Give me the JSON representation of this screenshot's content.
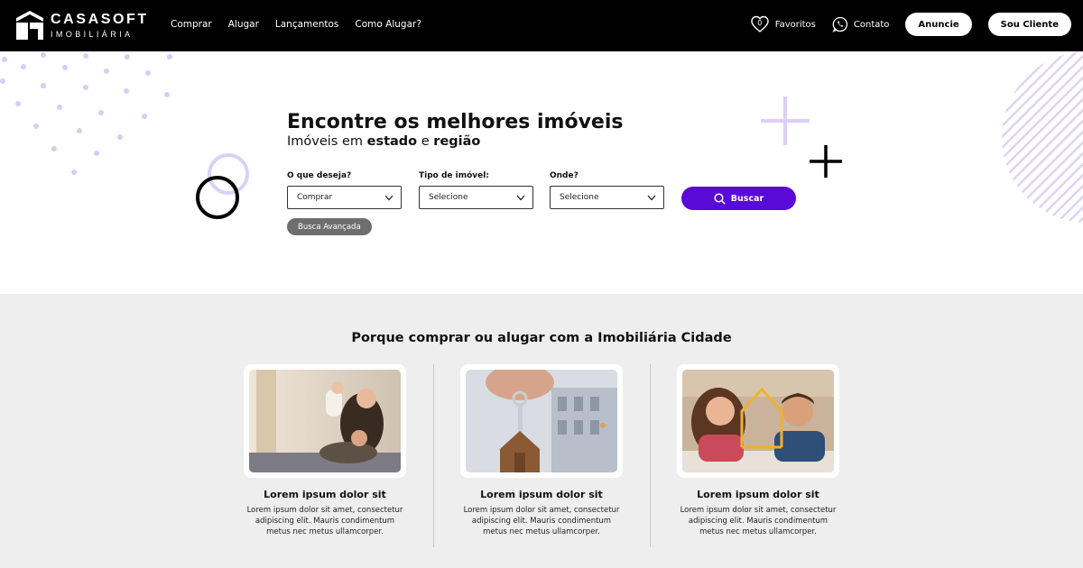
{
  "brand": {
    "name": "CASASOFT",
    "tagline": "IMOBILIÁRIA"
  },
  "nav": {
    "items": [
      "Comprar",
      "Alugar",
      "Lançamentos",
      "Como Alugar?"
    ]
  },
  "header_right": {
    "favorites_count": "0",
    "favorites_label": "Favoritos",
    "contact_label": "Contato",
    "announce_button": "Anuncie",
    "client_button": "Sou Cliente"
  },
  "hero": {
    "title": "Encontre os melhores imóveis",
    "subtitle_prefix": "Imóveis em ",
    "subtitle_state": "estado",
    "subtitle_mid": " e ",
    "subtitle_region": "região",
    "fields": [
      {
        "label": "O que deseja?",
        "value": "Comprar"
      },
      {
        "label": "Tipo de imóvel:",
        "value": "Selecione"
      },
      {
        "label": "Onde?",
        "value": "Selecione"
      }
    ],
    "search_button": "Buscar",
    "advanced_button": "Busca Avançada"
  },
  "features": {
    "title": "Porque comprar ou alugar com a Imobiliária Cidade",
    "cards": [
      {
        "title": "Lorem ipsum dolor sit",
        "text": "Lorem ipsum dolor sit amet, consectetur adipiscing elit. Mauris condimentum metus nec metus ullamcorper."
      },
      {
        "title": "Lorem ipsum dolor sit",
        "text": "Lorem ipsum dolor sit amet, consectetur adipiscing elit. Mauris condimentum metus nec metus ullamcorper."
      },
      {
        "title": "Lorem ipsum dolor sit",
        "text": "Lorem ipsum dolor sit amet, consectetur adipiscing elit. Mauris condimentum metus nec metus ullamcorper."
      }
    ]
  },
  "colors": {
    "accent": "#5a0ad6",
    "lavender": "#d9ccf5",
    "header_bg": "#000000",
    "section_bg": "#eeeeee"
  }
}
